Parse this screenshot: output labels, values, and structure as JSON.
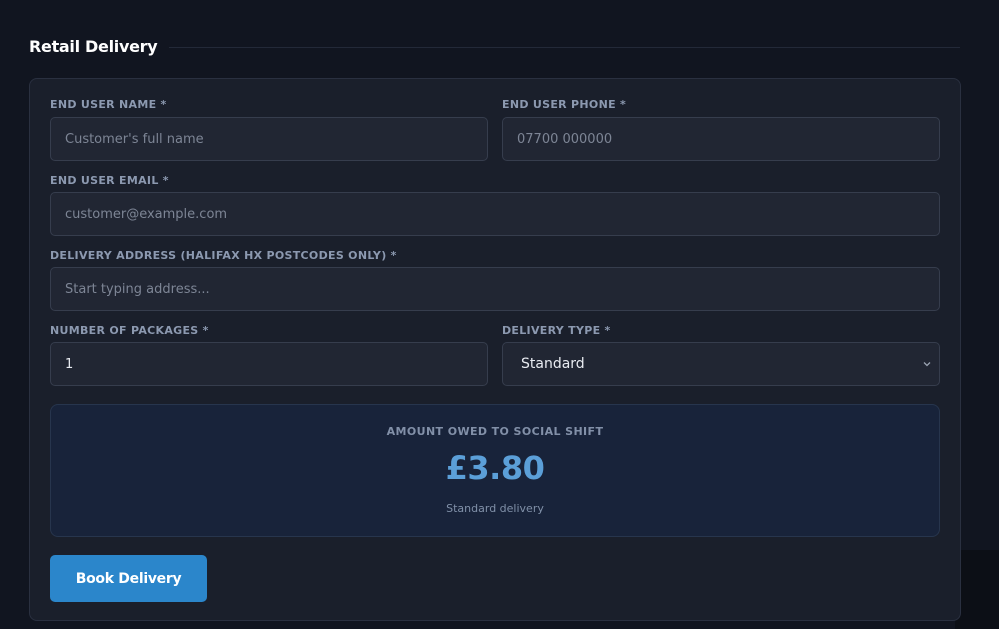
{
  "section": {
    "title": "Retail Delivery"
  },
  "form": {
    "name": {
      "label": "END USER NAME *",
      "placeholder": "Customer's full name",
      "value": ""
    },
    "phone": {
      "label": "END USER PHONE *",
      "placeholder": "07700 000000",
      "value": ""
    },
    "email": {
      "label": "END USER EMAIL *",
      "placeholder": "customer@example.com",
      "value": ""
    },
    "address": {
      "label": "DELIVERY ADDRESS (HALIFAX HX POSTCODES ONLY) *",
      "placeholder": "Start typing address...",
      "value": ""
    },
    "packages": {
      "label": "NUMBER OF PACKAGES *",
      "value": "1"
    },
    "delivery_type": {
      "label": "DELIVERY TYPE *",
      "selected": "Standard"
    }
  },
  "summary": {
    "label": "AMOUNT OWED TO SOCIAL SHIFT",
    "amount": "£3.80",
    "note": "Standard delivery"
  },
  "actions": {
    "book_label": "Book Delivery"
  },
  "colors": {
    "accent": "#2b86cb",
    "amount": "#5b9fd8",
    "background": "#111520",
    "card": "#1a1f2b"
  },
  "icons": {
    "select_chevron": "chevron-down-icon"
  }
}
